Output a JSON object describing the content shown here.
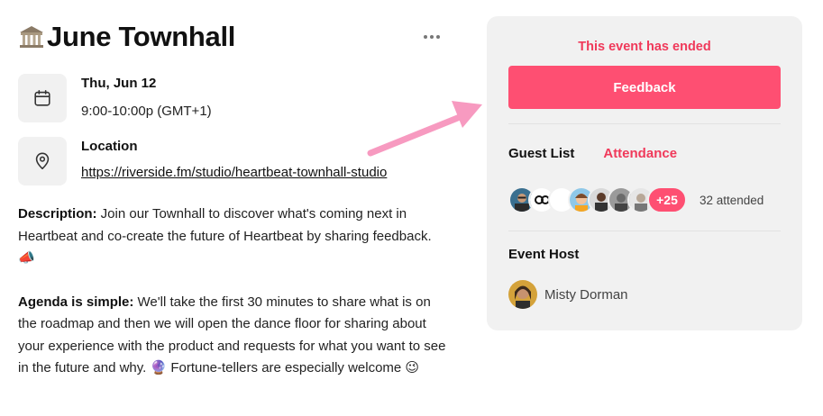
{
  "event": {
    "title": "June Townhall",
    "title_icon": "classical-building-emoji",
    "date": "Thu, Jun 12",
    "time": "9:00-10:00p (GMT+1)",
    "location_label": "Location",
    "location_url": "https://riverside.fm/studio/heartbeat-townhall-studio"
  },
  "description": {
    "label": "Description:",
    "text": " Join our Townhall to discover what's coming next in Heartbeat and co-create the future of Heartbeat by sharing feedback. 📣",
    "agenda_label": "Agenda is simple:",
    "agenda_text": " We'll take the first 30 minutes to share what is on the roadmap and then we will open the dance floor for sharing about your experience with the product and requests for what you want to see in the future and why. 🔮 Fortune-tellers are especially welcome 😉"
  },
  "panel": {
    "status": "This event has ended",
    "feedback_label": "Feedback",
    "tabs": [
      "Guest List",
      "Attendance"
    ],
    "more_count": "+25",
    "attended": "32 attended",
    "host_label": "Event Host",
    "host_name": "Misty Dorman"
  },
  "colors": {
    "accent": "#fe4f72",
    "accent_text": "#f0395a",
    "panel_bg": "#f1f1f1"
  }
}
